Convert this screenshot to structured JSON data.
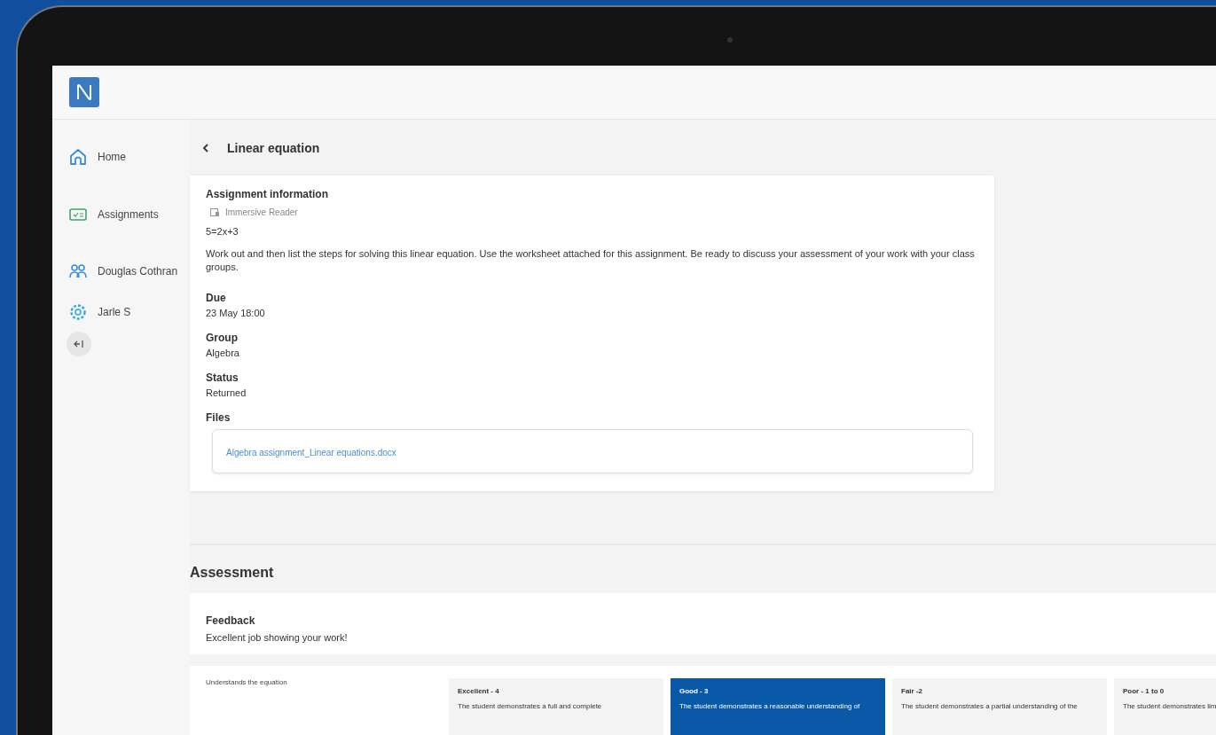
{
  "sidebar": {
    "items": [
      {
        "kind": "home",
        "label": "Home"
      },
      {
        "kind": "assignments",
        "label": "Assignments"
      },
      {
        "kind": "people",
        "label": "Douglas Cothran"
      },
      {
        "kind": "settings",
        "label": "Jarle S"
      }
    ]
  },
  "page": {
    "title": "Linear equation"
  },
  "assignment": {
    "heading": "Assignment information",
    "immersive_reader": "Immersive Reader",
    "equation": "5=2x+3",
    "instructions": "Work out and then list the steps for solving this linear equation. Use the worksheet attached for this assignment. Be ready to discuss your assessment of your work with your class groups.",
    "fields": [
      {
        "label": "Due",
        "value": "23 May 18:00"
      },
      {
        "label": "Group",
        "value": "Algebra"
      },
      {
        "label": "Status",
        "value": "Returned"
      }
    ],
    "files_label": "Files",
    "files": [
      "Algebra assignment_Linear equations.docx"
    ]
  },
  "assessment": {
    "title": "Assessment",
    "feedback_label": "Feedback",
    "feedback": "Excellent job showing your work!",
    "rubric": {
      "criterion": "Understands the equation",
      "levels": [
        {
          "title": "Excellent - 4",
          "description": "The student demonstrates a full and complete",
          "selected": false
        },
        {
          "title": "Good - 3",
          "description": "The student demonstrates a reasonable understanding of",
          "selected": true
        },
        {
          "title": "Fair -2",
          "description": "The student demonstrates a partial understanding of the",
          "selected": false
        },
        {
          "title": "Poor - 1 to 0",
          "description": "The student demonstrates lim",
          "selected": false
        }
      ]
    }
  }
}
